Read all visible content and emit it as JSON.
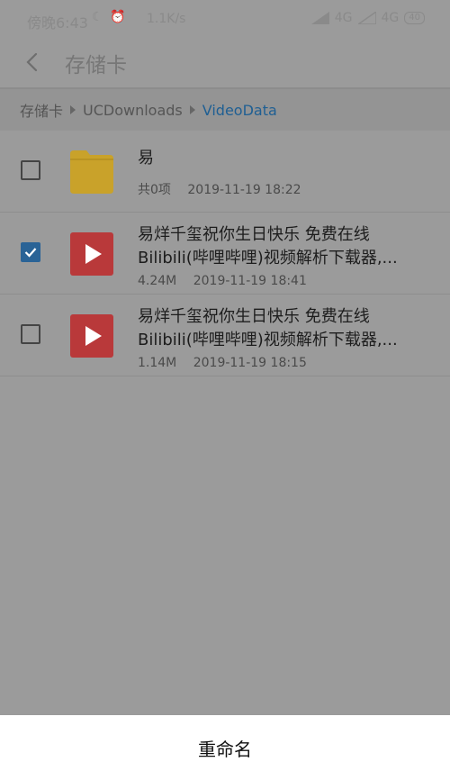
{
  "status_bar": {
    "time": "傍晚6:43",
    "speed": "1.1K/s",
    "network_1": "4G",
    "network_2": "4G",
    "battery": "40"
  },
  "app_bar": {
    "title": "存储卡"
  },
  "breadcrumb": [
    {
      "label": "存储卡"
    },
    {
      "label": "UCDownloads"
    },
    {
      "label": "VideoData"
    }
  ],
  "files": [
    {
      "type": "folder",
      "name_line1": "易",
      "name_line2": "",
      "size": "共0项",
      "date": "2019-11-19 18:22",
      "checked": false
    },
    {
      "type": "video",
      "name_line1": "易烊千玺祝你生日快乐 免费在线",
      "name_line2": "Bilibili(哔哩哔哩)视频解析下载器,...",
      "size": "4.24M",
      "date": "2019-11-19 18:41",
      "checked": true
    },
    {
      "type": "video",
      "name_line1": "易烊千玺祝你生日快乐 免费在线",
      "name_line2": "Bilibili(哔哩哔哩)视频解析下载器,...",
      "size": "1.14M",
      "date": "2019-11-19 18:15",
      "checked": false
    }
  ],
  "bottom_sheet": {
    "rename_label": "重命名"
  },
  "colors": {
    "accent": "#2a6396",
    "folder": "#c9a22a",
    "video": "#b9393a"
  }
}
